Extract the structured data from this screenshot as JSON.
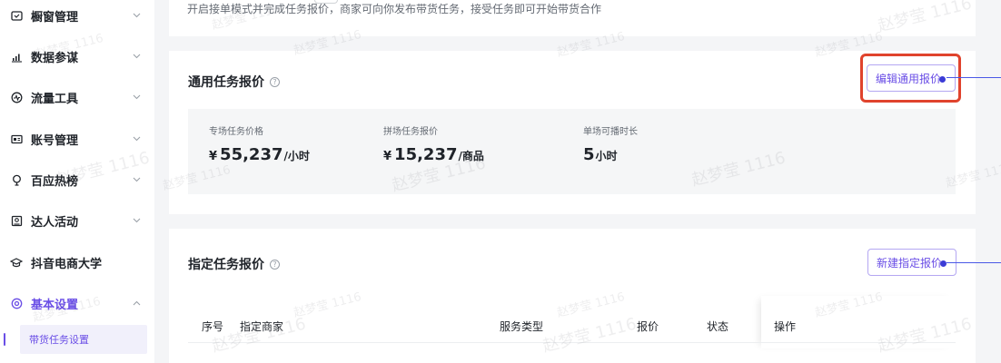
{
  "sidebar": {
    "items": [
      {
        "label": "橱窗管理",
        "icon": "storefront-icon",
        "expanded": false
      },
      {
        "label": "数据参谋",
        "icon": "bar-chart-icon",
        "expanded": false
      },
      {
        "label": "流量工具",
        "icon": "traffic-icon",
        "expanded": false
      },
      {
        "label": "账号管理",
        "icon": "id-card-icon",
        "expanded": false
      },
      {
        "label": "百应热榜",
        "icon": "bulb-icon",
        "expanded": false
      },
      {
        "label": "达人活动",
        "icon": "activity-icon",
        "expanded": false
      },
      {
        "label": "抖音电商大学",
        "icon": "graduation-cap-icon"
      },
      {
        "label": "基本设置",
        "icon": "settings-icon",
        "expanded": true,
        "active": true
      }
    ],
    "sub_items": [
      {
        "label": "带货任务设置",
        "active": true
      }
    ]
  },
  "intro": {
    "text": "开启接单模式并完成任务报价，商家可向你发布带货任务，接受任务即可开始带货合作"
  },
  "general_quote": {
    "title": "通用任务报价",
    "edit_button": "编辑通用报价",
    "prices": [
      {
        "label": "专场任务价格",
        "currency": "¥",
        "value": "55,237",
        "unit": "/小时"
      },
      {
        "label": "拼场任务报价",
        "currency": "¥",
        "value": "15,237",
        "unit": "/商品"
      },
      {
        "label": "单场可播时长",
        "currency": "",
        "value": "5",
        "unit": "小时"
      }
    ]
  },
  "designated_quote": {
    "title": "指定任务报价",
    "new_button": "新建指定报价",
    "columns": [
      "序号",
      "指定商家",
      "服务类型",
      "报价",
      "状态",
      "操作"
    ]
  },
  "watermark": {
    "text": "赵梦莹 1116"
  },
  "colors": {
    "accent": "#6a4ee6",
    "highlight_ring": "#e0432d",
    "leader_line": "#4a58e6"
  }
}
